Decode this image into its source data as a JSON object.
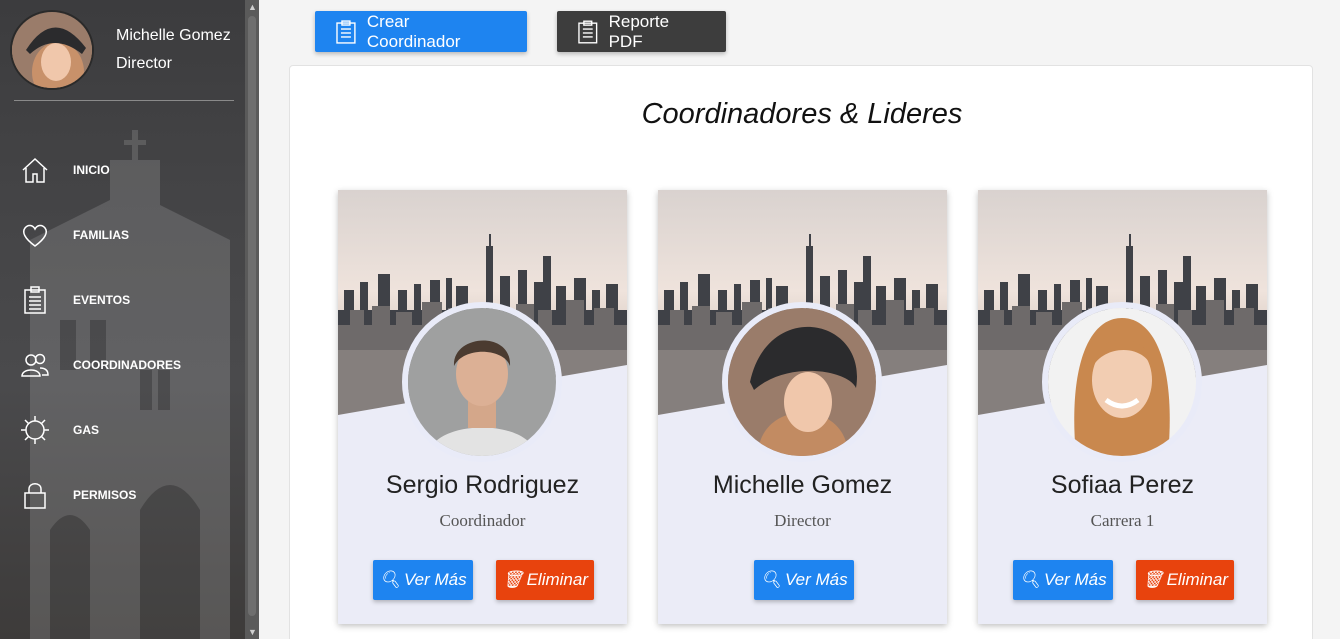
{
  "user": {
    "name": "Michelle Gomez",
    "role": "Director"
  },
  "nav": [
    {
      "label": "INICIO",
      "icon": "home-icon"
    },
    {
      "label": "FAMILIAS",
      "icon": "heart-icon"
    },
    {
      "label": "EVENTOS",
      "icon": "clipboard-icon"
    },
    {
      "label": "COORDINADORES",
      "icon": "users-icon"
    },
    {
      "label": "GAS",
      "icon": "gear-icon"
    },
    {
      "label": "PERMISOS",
      "icon": "lock-icon"
    }
  ],
  "toolbar": {
    "create_label": "Crear Coordinador",
    "report_label": "Reporte PDF"
  },
  "panel": {
    "title": "Coordinadores & Lideres"
  },
  "cards": [
    {
      "name": "Sergio Rodriguez",
      "role": "Coordinador",
      "view_label": "Ver Más",
      "delete_label": "Eliminar"
    },
    {
      "name": "Michelle Gomez",
      "role": "Director",
      "view_label": "Ver Más"
    },
    {
      "name": "Sofiaa Perez",
      "role": "Carrera 1",
      "view_label": "Ver Más",
      "delete_label": "Eliminar"
    }
  ],
  "colors": {
    "primary": "#1e84f0",
    "danger": "#e8430d",
    "dark": "#3d3d3d",
    "card_bg": "#ebecf7"
  }
}
